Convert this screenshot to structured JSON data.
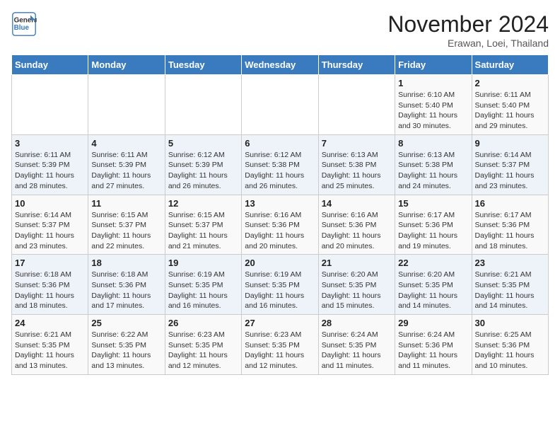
{
  "logo": {
    "line1": "General",
    "line2": "Blue"
  },
  "title": "November 2024",
  "location": "Erawan, Loei, Thailand",
  "weekdays": [
    "Sunday",
    "Monday",
    "Tuesday",
    "Wednesday",
    "Thursday",
    "Friday",
    "Saturday"
  ],
  "weeks": [
    [
      {
        "day": "",
        "info": ""
      },
      {
        "day": "",
        "info": ""
      },
      {
        "day": "",
        "info": ""
      },
      {
        "day": "",
        "info": ""
      },
      {
        "day": "",
        "info": ""
      },
      {
        "day": "1",
        "info": "Sunrise: 6:10 AM\nSunset: 5:40 PM\nDaylight: 11 hours and 30 minutes."
      },
      {
        "day": "2",
        "info": "Sunrise: 6:11 AM\nSunset: 5:40 PM\nDaylight: 11 hours and 29 minutes."
      }
    ],
    [
      {
        "day": "3",
        "info": "Sunrise: 6:11 AM\nSunset: 5:39 PM\nDaylight: 11 hours and 28 minutes."
      },
      {
        "day": "4",
        "info": "Sunrise: 6:11 AM\nSunset: 5:39 PM\nDaylight: 11 hours and 27 minutes."
      },
      {
        "day": "5",
        "info": "Sunrise: 6:12 AM\nSunset: 5:39 PM\nDaylight: 11 hours and 26 minutes."
      },
      {
        "day": "6",
        "info": "Sunrise: 6:12 AM\nSunset: 5:38 PM\nDaylight: 11 hours and 26 minutes."
      },
      {
        "day": "7",
        "info": "Sunrise: 6:13 AM\nSunset: 5:38 PM\nDaylight: 11 hours and 25 minutes."
      },
      {
        "day": "8",
        "info": "Sunrise: 6:13 AM\nSunset: 5:38 PM\nDaylight: 11 hours and 24 minutes."
      },
      {
        "day": "9",
        "info": "Sunrise: 6:14 AM\nSunset: 5:37 PM\nDaylight: 11 hours and 23 minutes."
      }
    ],
    [
      {
        "day": "10",
        "info": "Sunrise: 6:14 AM\nSunset: 5:37 PM\nDaylight: 11 hours and 23 minutes."
      },
      {
        "day": "11",
        "info": "Sunrise: 6:15 AM\nSunset: 5:37 PM\nDaylight: 11 hours and 22 minutes."
      },
      {
        "day": "12",
        "info": "Sunrise: 6:15 AM\nSunset: 5:37 PM\nDaylight: 11 hours and 21 minutes."
      },
      {
        "day": "13",
        "info": "Sunrise: 6:16 AM\nSunset: 5:36 PM\nDaylight: 11 hours and 20 minutes."
      },
      {
        "day": "14",
        "info": "Sunrise: 6:16 AM\nSunset: 5:36 PM\nDaylight: 11 hours and 20 minutes."
      },
      {
        "day": "15",
        "info": "Sunrise: 6:17 AM\nSunset: 5:36 PM\nDaylight: 11 hours and 19 minutes."
      },
      {
        "day": "16",
        "info": "Sunrise: 6:17 AM\nSunset: 5:36 PM\nDaylight: 11 hours and 18 minutes."
      }
    ],
    [
      {
        "day": "17",
        "info": "Sunrise: 6:18 AM\nSunset: 5:36 PM\nDaylight: 11 hours and 18 minutes."
      },
      {
        "day": "18",
        "info": "Sunrise: 6:18 AM\nSunset: 5:36 PM\nDaylight: 11 hours and 17 minutes."
      },
      {
        "day": "19",
        "info": "Sunrise: 6:19 AM\nSunset: 5:35 PM\nDaylight: 11 hours and 16 minutes."
      },
      {
        "day": "20",
        "info": "Sunrise: 6:19 AM\nSunset: 5:35 PM\nDaylight: 11 hours and 16 minutes."
      },
      {
        "day": "21",
        "info": "Sunrise: 6:20 AM\nSunset: 5:35 PM\nDaylight: 11 hours and 15 minutes."
      },
      {
        "day": "22",
        "info": "Sunrise: 6:20 AM\nSunset: 5:35 PM\nDaylight: 11 hours and 14 minutes."
      },
      {
        "day": "23",
        "info": "Sunrise: 6:21 AM\nSunset: 5:35 PM\nDaylight: 11 hours and 14 minutes."
      }
    ],
    [
      {
        "day": "24",
        "info": "Sunrise: 6:21 AM\nSunset: 5:35 PM\nDaylight: 11 hours and 13 minutes."
      },
      {
        "day": "25",
        "info": "Sunrise: 6:22 AM\nSunset: 5:35 PM\nDaylight: 11 hours and 13 minutes."
      },
      {
        "day": "26",
        "info": "Sunrise: 6:23 AM\nSunset: 5:35 PM\nDaylight: 11 hours and 12 minutes."
      },
      {
        "day": "27",
        "info": "Sunrise: 6:23 AM\nSunset: 5:35 PM\nDaylight: 11 hours and 12 minutes."
      },
      {
        "day": "28",
        "info": "Sunrise: 6:24 AM\nSunset: 5:35 PM\nDaylight: 11 hours and 11 minutes."
      },
      {
        "day": "29",
        "info": "Sunrise: 6:24 AM\nSunset: 5:36 PM\nDaylight: 11 hours and 11 minutes."
      },
      {
        "day": "30",
        "info": "Sunrise: 6:25 AM\nSunset: 5:36 PM\nDaylight: 11 hours and 10 minutes."
      }
    ]
  ]
}
